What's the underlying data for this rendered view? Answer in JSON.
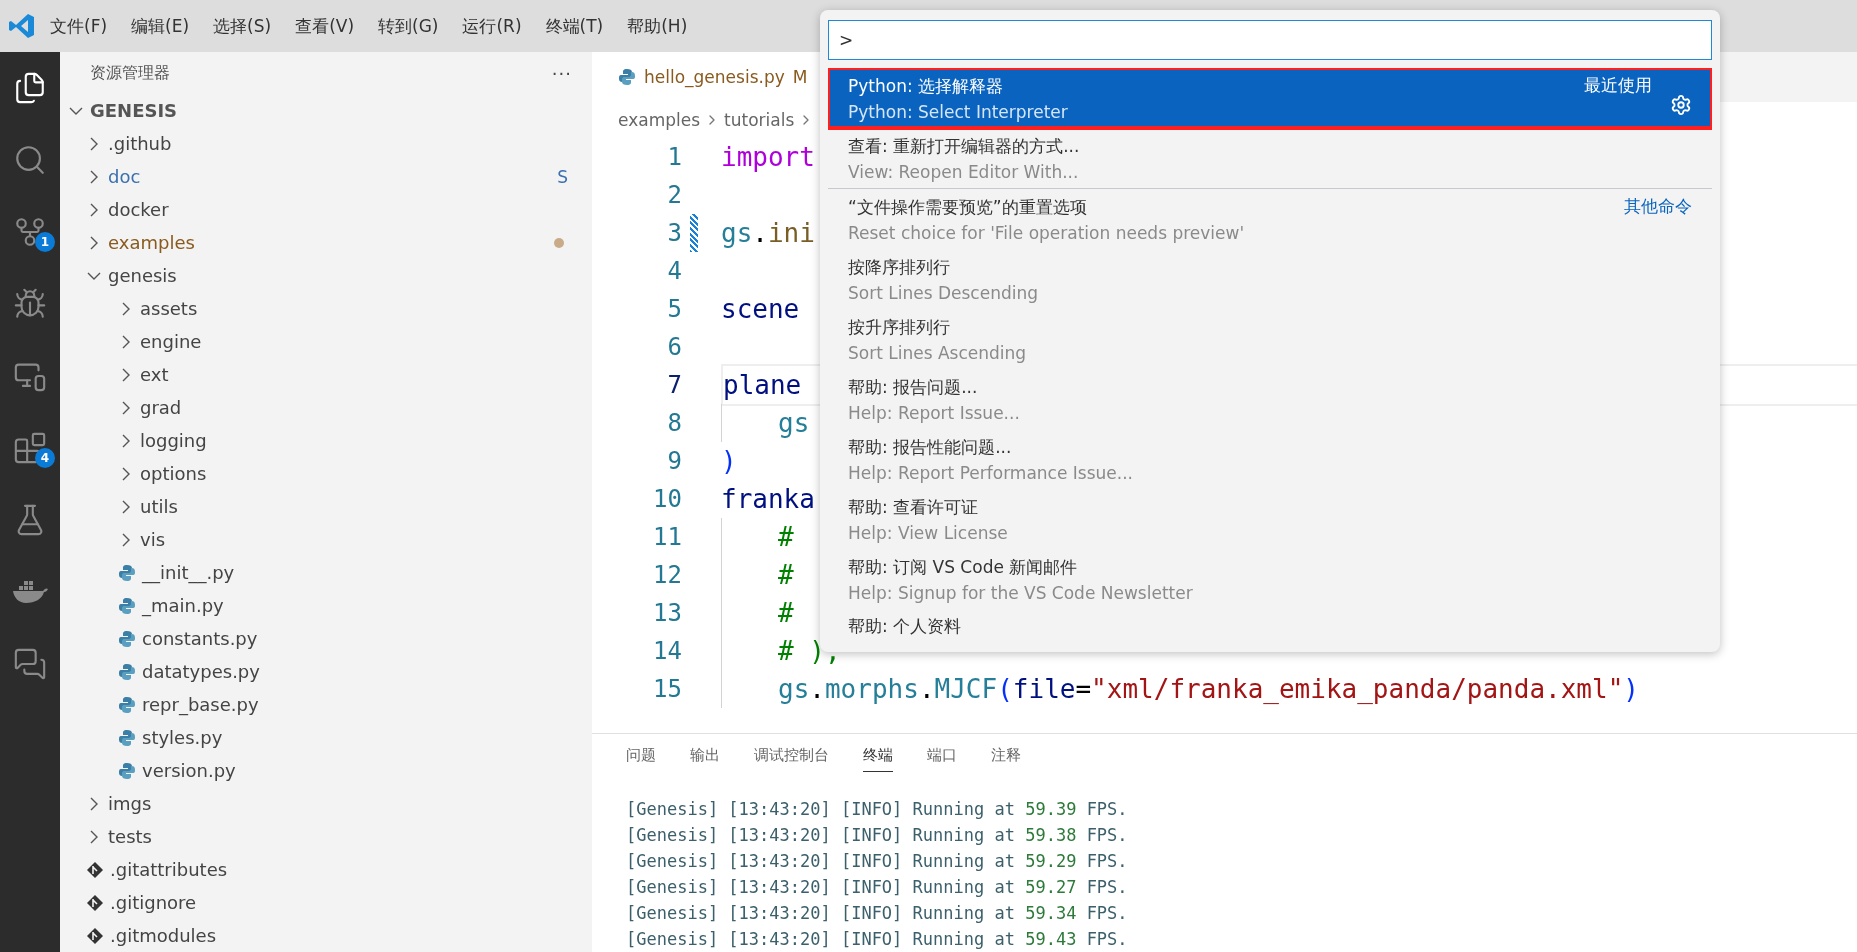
{
  "menu_bar": {
    "items": [
      "文件(F)",
      "编辑(E)",
      "选择(S)",
      "查看(V)",
      "转到(G)",
      "运行(R)",
      "终端(T)",
      "帮助(H)"
    ]
  },
  "activity_bar": {
    "items": [
      {
        "kind": "explorer",
        "selected": true
      },
      {
        "kind": "search",
        "selected": false
      },
      {
        "kind": "source_control",
        "selected": false,
        "badge": "1"
      },
      {
        "kind": "run_debug",
        "selected": false
      },
      {
        "kind": "remote",
        "selected": false
      },
      {
        "kind": "extensions",
        "selected": false,
        "badge": "4"
      },
      {
        "kind": "testing",
        "selected": false
      },
      {
        "kind": "docker",
        "selected": false
      },
      {
        "kind": "chat",
        "selected": false
      }
    ]
  },
  "sidebar": {
    "title": "资源管理器",
    "more": "···",
    "tree": {
      "label": "GENESIS",
      "expanded": true,
      "children": [
        {
          "label": ".github",
          "kind": "folder",
          "expanded": false,
          "color": "#444444",
          "modified": false
        },
        {
          "label": "doc",
          "kind": "folder",
          "expanded": false,
          "color": "#3b6fb0",
          "modified": false,
          "badge": "S"
        },
        {
          "label": "docker",
          "kind": "folder",
          "expanded": false,
          "color": "#444444",
          "modified": false
        },
        {
          "label": "examples",
          "kind": "folder",
          "expanded": false,
          "color": "#8a5a1e",
          "modified": true
        },
        {
          "label": "genesis",
          "kind": "folder",
          "expanded": true,
          "color": "#444444",
          "modified": false,
          "children": [
            {
              "label": "assets",
              "kind": "folder",
              "expanded": false,
              "color": "#444444",
              "modified": false
            },
            {
              "label": "engine",
              "kind": "folder",
              "expanded": false,
              "color": "#444444",
              "modified": false
            },
            {
              "label": "ext",
              "kind": "folder",
              "expanded": false,
              "color": "#444444",
              "modified": false
            },
            {
              "label": "grad",
              "kind": "folder",
              "expanded": false,
              "color": "#444444",
              "modified": false
            },
            {
              "label": "logging",
              "kind": "folder",
              "expanded": false,
              "color": "#444444",
              "modified": false
            },
            {
              "label": "options",
              "kind": "folder",
              "expanded": false,
              "color": "#444444",
              "modified": false
            },
            {
              "label": "utils",
              "kind": "folder",
              "expanded": false,
              "color": "#444444",
              "modified": false
            },
            {
              "label": "vis",
              "kind": "folder",
              "expanded": false,
              "color": "#444444",
              "modified": false
            },
            {
              "label": "__init__.py",
              "kind": "python",
              "color": "#444444",
              "modified": false
            },
            {
              "label": "_main.py",
              "kind": "python",
              "color": "#444444",
              "modified": false
            },
            {
              "label": "constants.py",
              "kind": "python",
              "color": "#444444",
              "modified": false
            },
            {
              "label": "datatypes.py",
              "kind": "python",
              "color": "#444444",
              "modified": false
            },
            {
              "label": "repr_base.py",
              "kind": "python",
              "color": "#444444",
              "modified": false
            },
            {
              "label": "styles.py",
              "kind": "python",
              "color": "#444444",
              "modified": false
            },
            {
              "label": "version.py",
              "kind": "python",
              "color": "#444444",
              "modified": false
            }
          ]
        },
        {
          "label": "imgs",
          "kind": "folder",
          "expanded": false,
          "color": "#444444",
          "modified": false
        },
        {
          "label": "tests",
          "kind": "folder",
          "expanded": false,
          "color": "#444444",
          "modified": false
        },
        {
          "label": ".gitattributes",
          "kind": "git",
          "color": "#444444",
          "modified": false
        },
        {
          "label": ".gitignore",
          "kind": "git",
          "color": "#444444",
          "modified": false
        },
        {
          "label": ".gitmodules",
          "kind": "git",
          "color": "#444444",
          "modified": false
        }
      ]
    }
  },
  "editor": {
    "tab": {
      "label": "hello_genesis.py",
      "modified_mark": "M",
      "selected": true
    },
    "breadcrumbs": [
      "examples",
      "tutorials"
    ],
    "lines": [
      {
        "number": "1",
        "indented": false,
        "current": false,
        "modified": false,
        "tokens": [
          {
            "text": "import",
            "kind": "keyword"
          }
        ]
      },
      {
        "number": "2",
        "indented": false,
        "current": false,
        "modified": false
      },
      {
        "number": "3",
        "indented": false,
        "current": false,
        "modified": true,
        "tokens": [
          {
            "text": "gs",
            "kind": "module"
          },
          {
            "text": ".",
            "kind": "plain"
          },
          {
            "text": "ini",
            "kind": "function"
          }
        ]
      },
      {
        "number": "4",
        "indented": false,
        "current": false,
        "modified": false
      },
      {
        "number": "5",
        "indented": false,
        "current": false,
        "modified": false,
        "tokens": [
          {
            "text": "scene",
            "kind": "variable"
          }
        ]
      },
      {
        "number": "6",
        "indented": false,
        "current": false,
        "modified": false
      },
      {
        "number": "7",
        "indented": false,
        "current": true,
        "modified": false,
        "tokens": [
          {
            "text": "plane",
            "kind": "variable"
          }
        ]
      },
      {
        "number": "8",
        "indented": true,
        "current": false,
        "modified": false,
        "tokens": [
          {
            "text": "gs",
            "kind": "module"
          }
        ]
      },
      {
        "number": "9",
        "indented": false,
        "current": false,
        "modified": false,
        "tokens": [
          {
            "text": ")",
            "kind": "bracket"
          }
        ]
      },
      {
        "number": "10",
        "indented": false,
        "current": false,
        "modified": false,
        "tokens": [
          {
            "text": "franka",
            "kind": "variable"
          }
        ]
      },
      {
        "number": "11",
        "indented": true,
        "current": false,
        "modified": false,
        "tokens": [
          {
            "text": "#",
            "kind": "comment"
          }
        ]
      },
      {
        "number": "12",
        "indented": true,
        "current": false,
        "modified": false,
        "tokens": [
          {
            "text": "#",
            "kind": "comment"
          }
        ]
      },
      {
        "number": "13",
        "indented": true,
        "current": false,
        "modified": false,
        "tokens": [
          {
            "text": "#",
            "kind": "comment"
          }
        ]
      },
      {
        "number": "14",
        "indented": true,
        "current": false,
        "modified": false,
        "tokens": [
          {
            "text": "# ),",
            "kind": "comment"
          }
        ]
      },
      {
        "number": "15",
        "indented": true,
        "current": false,
        "modified": false,
        "tokens": [
          {
            "text": "gs",
            "kind": "module"
          },
          {
            "text": ".",
            "kind": "plain"
          },
          {
            "text": "morphs",
            "kind": "module"
          },
          {
            "text": ".",
            "kind": "plain"
          },
          {
            "text": "MJCF",
            "kind": "module"
          },
          {
            "text": "(",
            "kind": "bracket"
          },
          {
            "text": "file",
            "kind": "variable"
          },
          {
            "text": "=",
            "kind": "plain"
          },
          {
            "text": "\"xml/franka_emika_panda/panda.xml\"",
            "kind": "string"
          },
          {
            "text": ")",
            "kind": "bracket"
          }
        ]
      }
    ]
  },
  "command_palette": {
    "input": {
      "value": ">"
    },
    "items": [
      {
        "title": "Python: 选择解释器",
        "detail": "Python: Select Interpreter",
        "group": "最近使用",
        "selected": true,
        "highlighted": true,
        "separator": false
      },
      {
        "title": "查看: 重新打开编辑器的方式...",
        "detail": "View: Reopen Editor With...",
        "selected": false,
        "highlighted": false,
        "separator": false
      },
      {
        "title": "“文件操作需要预览”的重置选项",
        "detail": "Reset choice for 'File operation needs preview'",
        "group": "其他命令",
        "selected": false,
        "highlighted": false,
        "separator": true
      },
      {
        "title": "按降序排列行",
        "detail": "Sort Lines Descending",
        "selected": false,
        "highlighted": false,
        "separator": false
      },
      {
        "title": "按升序排列行",
        "detail": "Sort Lines Ascending",
        "selected": false,
        "highlighted": false,
        "separator": false
      },
      {
        "title": "帮助: 报告问题...",
        "detail": "Help: Report Issue...",
        "selected": false,
        "highlighted": false,
        "separator": false
      },
      {
        "title": "帮助: 报告性能问题...",
        "detail": "Help: Report Performance Issue...",
        "selected": false,
        "highlighted": false,
        "separator": false
      },
      {
        "title": "帮助: 查看许可证",
        "detail": "Help: View License",
        "selected": false,
        "highlighted": false,
        "separator": false
      },
      {
        "title": "帮助: 订阅 VS Code 新闻邮件",
        "detail": "Help: Signup for the VS Code Newsletter",
        "selected": false,
        "highlighted": false,
        "separator": false
      },
      {
        "title": "帮助: 个人资料",
        "selected": false,
        "highlighted": false,
        "separator": false
      }
    ]
  },
  "panel": {
    "tabs": [
      {
        "label": "问题",
        "selected": false
      },
      {
        "label": "输出",
        "selected": false
      },
      {
        "label": "调试控制台",
        "selected": false
      },
      {
        "label": "终端",
        "selected": true
      },
      {
        "label": "端口",
        "selected": false
      },
      {
        "label": "注释",
        "selected": false
      }
    ],
    "terminal_lines": [
      {
        "prefix": "[Genesis] [13:43:20] [INFO] Running at",
        "value": "59.39",
        "suffix": "FPS."
      },
      {
        "prefix": "[Genesis] [13:43:20] [INFO] Running at",
        "value": "59.38",
        "suffix": "FPS."
      },
      {
        "prefix": "[Genesis] [13:43:20] [INFO] Running at",
        "value": "59.29",
        "suffix": "FPS."
      },
      {
        "prefix": "[Genesis] [13:43:20] [INFO] Running at",
        "value": "59.27",
        "suffix": "FPS."
      },
      {
        "prefix": "[Genesis] [13:43:20] [INFO] Running at",
        "value": "59.34",
        "suffix": "FPS."
      },
      {
        "prefix": "[Genesis] [13:43:20] [INFO] Running at",
        "value": "59.43",
        "suffix": "FPS."
      }
    ]
  }
}
